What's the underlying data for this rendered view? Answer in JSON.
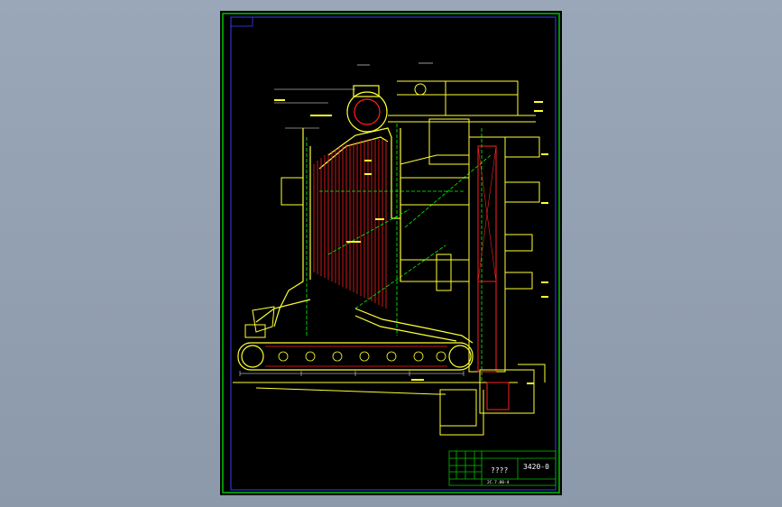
{
  "drawing": {
    "title_block": {
      "drawing_number": "3420-0",
      "title": "????",
      "footer_code": "2C.7.80-4"
    },
    "colors": {
      "background_outer": "#9aa7b8",
      "sheet": "#000000",
      "frame": "#00c000",
      "inner_frame": "#3a3aff",
      "structure": "#ffff33",
      "tubes": "#ff2020",
      "centerlines": "#00ff00",
      "annotations": "#ffffff"
    }
  }
}
